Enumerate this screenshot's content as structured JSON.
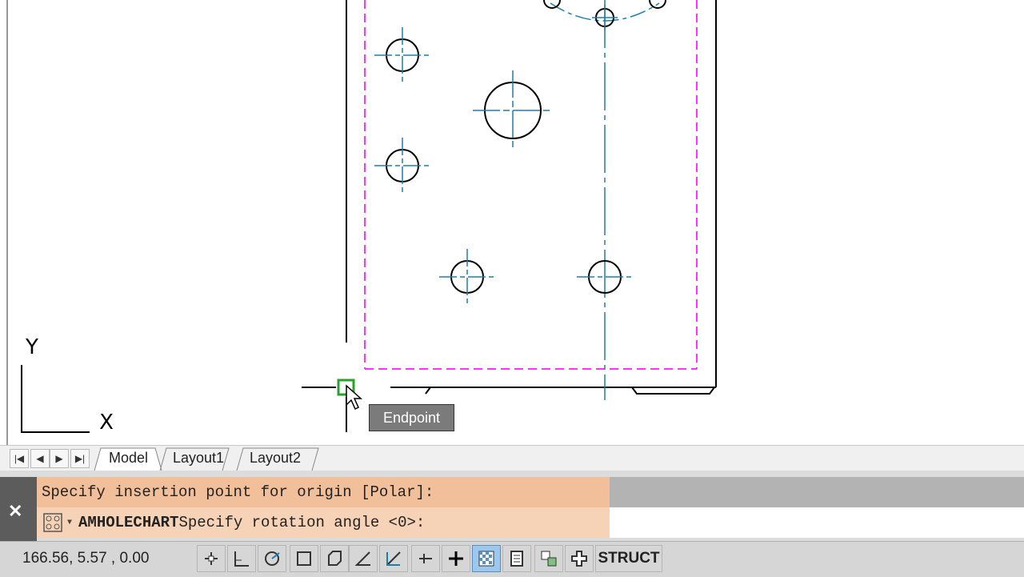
{
  "viewport": {
    "ucs_y_label": "Y",
    "ucs_x_label": "X",
    "snap_tooltip": "Endpoint"
  },
  "tabs": {
    "nav": [
      "first-icon",
      "prev-icon",
      "next-icon",
      "last-icon"
    ],
    "items": [
      {
        "label": "Model",
        "active": true
      },
      {
        "label": "Layout1",
        "active": false
      },
      {
        "label": "Layout2",
        "active": false
      }
    ]
  },
  "command": {
    "history_line": "Specify insertion point for origin [Polar]:",
    "command_name": "AMHOLECHART",
    "prompt": " Specify rotation angle <0>:"
  },
  "status": {
    "coordinates": "166.56, 5.57 , 0.00",
    "struct_label": "STRUCT",
    "buttons": [
      {
        "name": "infer-constraints-icon",
        "on": false
      },
      {
        "name": "snap-mode-icon",
        "on": false
      },
      {
        "name": "polar-tracking-icon",
        "on": false
      },
      {
        "name": "object-snap-icon",
        "on": false
      },
      {
        "name": "3d-object-snap-icon",
        "on": false
      },
      {
        "name": "object-snap-tracking-icon",
        "on": false
      },
      {
        "name": "dynamic-ucs-icon",
        "on": false
      },
      {
        "name": "dynamic-input-icon",
        "on": false
      },
      {
        "name": "lineweight-icon",
        "on": false
      },
      {
        "name": "transparency-icon",
        "on": true
      },
      {
        "name": "quick-properties-icon",
        "on": false
      },
      {
        "name": "selection-cycling-icon",
        "on": false
      },
      {
        "name": "annotation-monitor-icon",
        "on": false
      }
    ]
  },
  "colors": {
    "centerline": "#1f7ea8",
    "boundary": "#ff33ff",
    "snap_marker": "#2ca02c",
    "transparency_on": "#9cc7ee",
    "prompt_bg": "#f2bf9b"
  }
}
